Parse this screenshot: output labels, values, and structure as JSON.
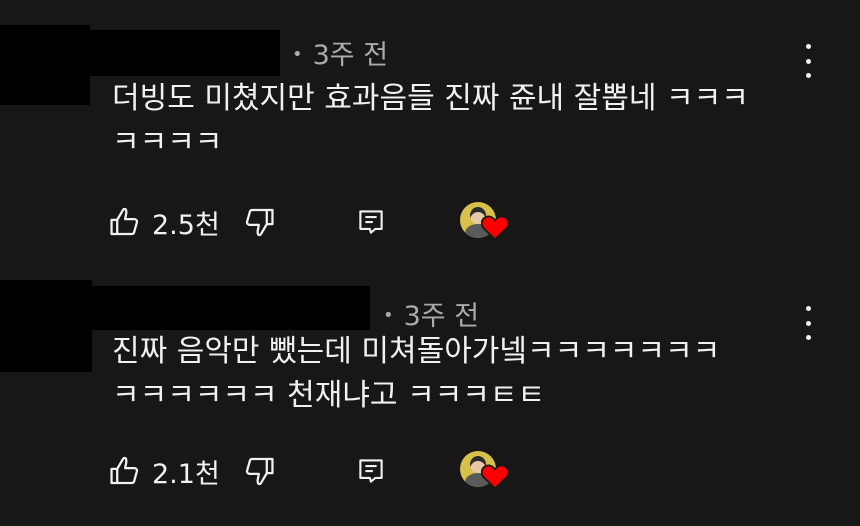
{
  "comments": [
    {
      "time": "3주 전",
      "text": "더빙도 미쳤지만 효과음들 진짜 쥰내 잘뽑네 ㅋㅋㅋ\nㅋㅋㅋㅋ",
      "likes": "2.5천"
    },
    {
      "time": "3주 전",
      "text": "진짜 음악만 뺐는데 미쳐돌아가넼ㅋㅋㅋㅋㅋㅋㅋ\nㅋㅋㅋㅋㅋㅋ 천재냐고 ㅋㅋㅋㅌㅌ",
      "likes": "2.1천"
    }
  ],
  "icons": {
    "like": "thumbs-up-icon",
    "dislike": "thumbs-down-icon",
    "reply": "reply-icon",
    "more": "more-vertical-icon",
    "heart": "heart-icon"
  },
  "colors": {
    "background": "#171717",
    "text": "#f1f1f1",
    "meta": "#aaaaaa",
    "heart": "#ff0000"
  }
}
